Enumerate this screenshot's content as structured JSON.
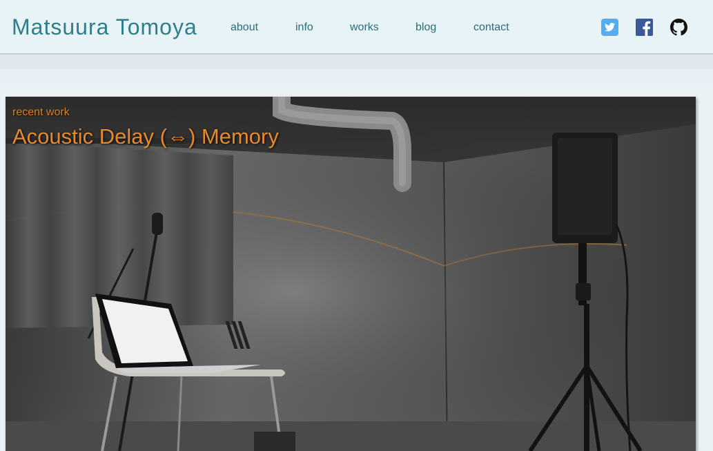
{
  "header": {
    "brand": "Matsuura Tomoya",
    "nav": [
      {
        "label": "about"
      },
      {
        "label": "info"
      },
      {
        "label": "works"
      },
      {
        "label": "blog"
      },
      {
        "label": "contact"
      }
    ],
    "social": [
      {
        "icon": "twitter-icon",
        "color": "#55acee"
      },
      {
        "icon": "facebook-icon",
        "color": "#3b5998"
      },
      {
        "icon": "github-icon",
        "color": "#111111"
      }
    ]
  },
  "hero": {
    "kicker": "recent work",
    "title": "Acoustic Delay (⇔) Memory",
    "title_color": "#e68a2e"
  }
}
